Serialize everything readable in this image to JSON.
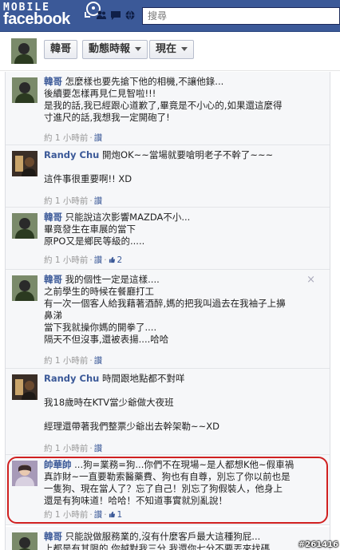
{
  "brand": {
    "top": "MOBILE",
    "name": "facebook"
  },
  "search": {
    "placeholder": "搜尋"
  },
  "profile": {
    "name": "韓哥",
    "timeline_label": "動態時報",
    "now_label": "現在"
  },
  "comments": [
    {
      "author": "韓哥",
      "lines": [
        "怎麼樣也要先搶下他的相機,不讓他錄...",
        "後續要怎樣再見仁見智啦!!!",
        "是我的話,我已經跟心道歉了,畢竟是不小心的,如果還這麼得",
        "寸進尺的話,我想我一定開砲了!"
      ],
      "time": "約 1 小時前",
      "like": "讚"
    },
    {
      "author": "Randy Chu",
      "lines": [
        "開炮OK~~當場就要嗆明老子不幹了~~~",
        "",
        "這件事很重要啊!! XD"
      ],
      "time": "約 1 小時前",
      "like": "讚"
    },
    {
      "author": "韓哥",
      "lines": [
        "只能說這次影響MAZDA不小...",
        "畢竟發生在車展的當下",
        "原PO又是鄉民等級的....."
      ],
      "time": "約 1 小時前",
      "like": "讚",
      "likes": "2"
    },
    {
      "author": "韓哥",
      "lines": [
        "我的個性一定是這樣....",
        "之前學生的時候在餐廳打工",
        "有一次一個客人給我藉著酒醉,媽的把我叫過去在我袖子上擤",
        "鼻涕",
        "當下我就操你媽的開拳了....",
        "隔天不但沒事,還被表揚....哈哈"
      ],
      "time": "約 1 小時前",
      "like": "讚",
      "close": "×"
    },
    {
      "author": "Randy Chu",
      "lines": [
        "時間跟地點都不對咩",
        "",
        "我18歲時在KTV當少爺做大夜班",
        "",
        "經理還帶著我們整票少爺出去幹架勒~~XD"
      ],
      "time": "約 1 小時前",
      "like": "讚"
    },
    {
      "author": "帥華帥",
      "lines": [
        "...狗=業務=狗...你們不在現場~是人都想K他~假車禍",
        "真詐財~一直要勒索醫藥費、狗也有自尊，別忘了你以前也是",
        "一隻狗、現在當人了？忘了自己！別忘了狗假裝人，他身上",
        "還是有狗味道！哈哈！不知道事實就別亂說！"
      ],
      "time": "約 1 小時前",
      "like": "讚",
      "likes": "1"
    },
    {
      "author": "韓哥",
      "lines": [
        "只能說做服務業的,沒有什麼客戶最大這種狗屁...",
        "上都是有其限的,你越對我三分,我還你七分不要丟來找碼"
      ],
      "time": "",
      "like": ""
    }
  ],
  "watermark": "#261416",
  "colors": {
    "fb_blue": "#3b5998",
    "link": "#3b5998",
    "highlight": "#d02020"
  }
}
